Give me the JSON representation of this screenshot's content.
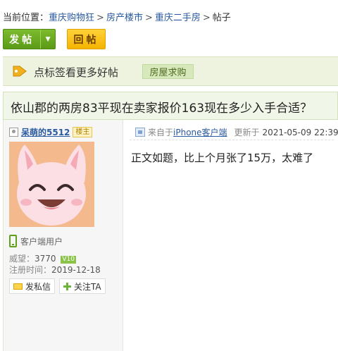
{
  "breadcrumb": {
    "label": "当前位置：",
    "items": [
      "重庆购物狂",
      "房产楼市",
      "重庆二手房"
    ],
    "current": "帖子",
    "separator": ">"
  },
  "buttons": {
    "post_label": "发帖",
    "reply_label": "回帖"
  },
  "tagbar": {
    "text": "点标签看更多好帖",
    "tag": "房屋求购"
  },
  "thread": {
    "title": "依山郡的两房83平现在卖家报价163现在多少入手合适？"
  },
  "author": {
    "name": "呆萌的5512",
    "badge": "楼主",
    "client_label": "客户端用户",
    "reputation_label": "威望：",
    "reputation": "3770",
    "level": "V10",
    "reg_label": "注册时间：",
    "reg_date": "2019-12-18",
    "message_button": "发私信",
    "follow_button": "关注TA"
  },
  "post": {
    "source_prefix": "来自于",
    "source_client": "iPhone客户端",
    "updated_label": "更新于",
    "updated_time": "2021-05-09 22:39",
    "content": "正文如题，比上个月张了15万，太难了"
  },
  "colors": {
    "accent_green": "#5a9a16",
    "accent_yellow": "#f5b400",
    "link_blue": "#2a5aa0"
  }
}
